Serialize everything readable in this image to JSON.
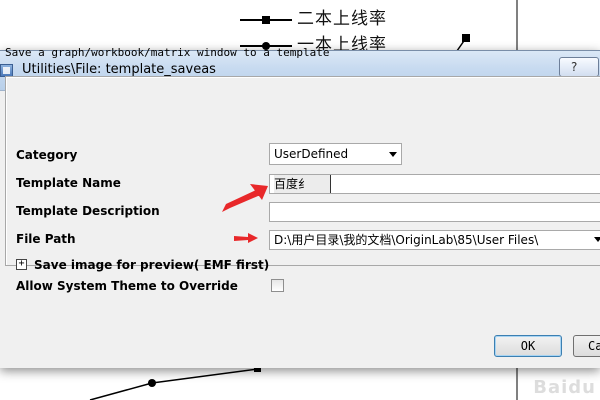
{
  "background_graph": {
    "legend": [
      {
        "label": "二本上线率"
      },
      {
        "label": "一本上线率"
      }
    ],
    "watermark": "Baidu"
  },
  "dialog": {
    "title": "Utilities\\File: template_saveas",
    "help_label": "?",
    "description": "Save a graph/workbook/matrix window to a template",
    "fields": {
      "category": {
        "label": "Category",
        "value": "UserDefined"
      },
      "template_name": {
        "label": "Template Name",
        "value": "百度纟"
      },
      "template_description": {
        "label": "Template Description",
        "value": ""
      },
      "file_path": {
        "label": "File Path",
        "value": "D:\\用户目录\\我的文档\\OriginLab\\85\\User Files\\"
      },
      "save_image": {
        "label": "Save image for preview( EMF first)",
        "toggle": "+"
      },
      "allow_theme": {
        "label": "Allow System Theme to Override",
        "checked": false
      }
    },
    "buttons": {
      "ok": "OK",
      "cancel": "Ca"
    }
  },
  "colors": {
    "annotation_arrow": "#e8282a",
    "titlebar": "#c7daf0",
    "dialog_bg": "#f0f0f0"
  }
}
